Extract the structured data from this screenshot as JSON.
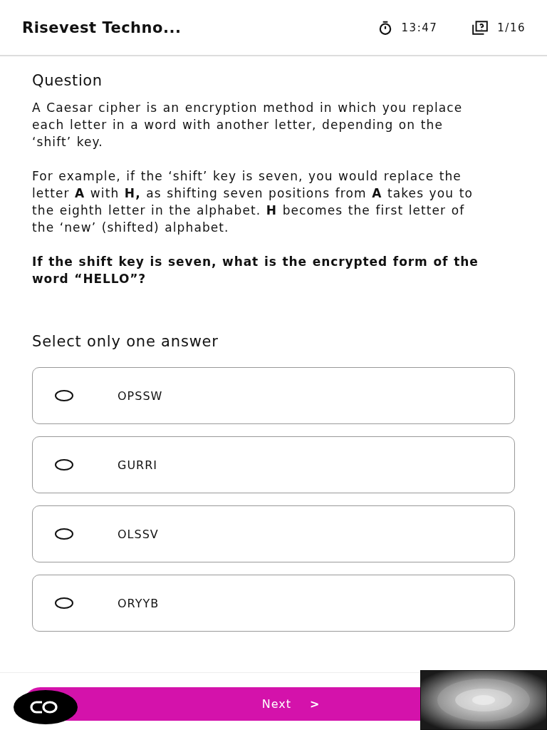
{
  "header": {
    "title": "Risevest Techno...",
    "timer": "13:47",
    "progress": "1/16"
  },
  "question": {
    "heading": "Question",
    "paragraphs": [
      "A Caesar cipher is an encryption method in which you replace each letter in a word with another letter, depending on the ‘shift’ key.",
      "For example, if the ‘shift’ key is seven, you would replace the letter **A** with **H,** as shifting seven positions from **A** takes you to the eighth letter in the alphabet. **H** becomes the first letter of the ‘new’ (shifted) alphabet."
    ],
    "prompt": "If the shift key is seven, what is the encrypted form of the word “HELLO”?"
  },
  "instruction": "Select only one answer",
  "options": [
    {
      "label": "OPSSW",
      "selected": false
    },
    {
      "label": "GURRI",
      "selected": false
    },
    {
      "label": "OLSSV",
      "selected": false
    },
    {
      "label": "ORYYB",
      "selected": false
    }
  ],
  "next_button": {
    "label": "Next",
    "icon_text": ">"
  }
}
